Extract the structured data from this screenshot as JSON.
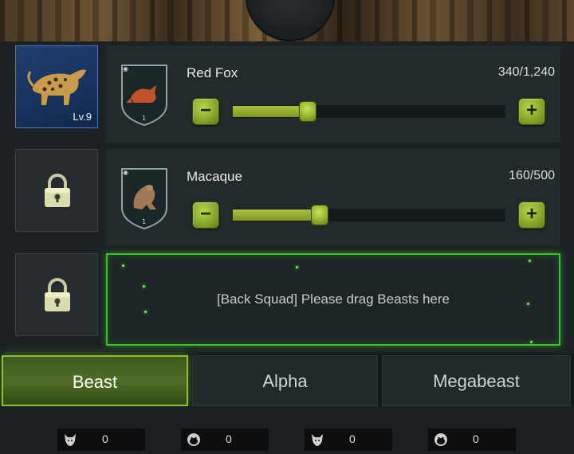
{
  "squad": {
    "slots": [
      {
        "state": "unlocked",
        "level": "Lv.9",
        "beast": "leopard"
      },
      {
        "state": "locked",
        "icon": "padlock-icon"
      },
      {
        "state": "locked",
        "icon": "padlock-icon"
      }
    ],
    "rows": [
      {
        "name": "Red Fox",
        "count": "340/1,240",
        "value": 340,
        "max": 1240,
        "shield_icon": "wolf-head-icon",
        "shield_number": "1"
      },
      {
        "name": "Macaque",
        "count": "160/500",
        "value": 160,
        "max": 500,
        "shield_icon": "ape-head-icon",
        "shield_number": "1"
      }
    ],
    "drop_zone": {
      "text": "[Back Squad] Please drag Beasts here"
    }
  },
  "tabs": [
    {
      "label": "Beast",
      "active": true
    },
    {
      "label": "Alpha",
      "active": false
    },
    {
      "label": "Megabeast",
      "active": false
    }
  ],
  "counters": [
    {
      "icon": "wolf-head-icon",
      "value": "0"
    },
    {
      "icon": "ape-head-icon",
      "value": "0"
    },
    {
      "icon": "wolf-head-icon",
      "value": "0"
    },
    {
      "icon": "ape-head-icon",
      "value": "0"
    }
  ],
  "colors": {
    "accent_green": "#8dbf2f",
    "drop_border": "#3fbf2a",
    "active_slot_blue": "#1f3d6e"
  }
}
